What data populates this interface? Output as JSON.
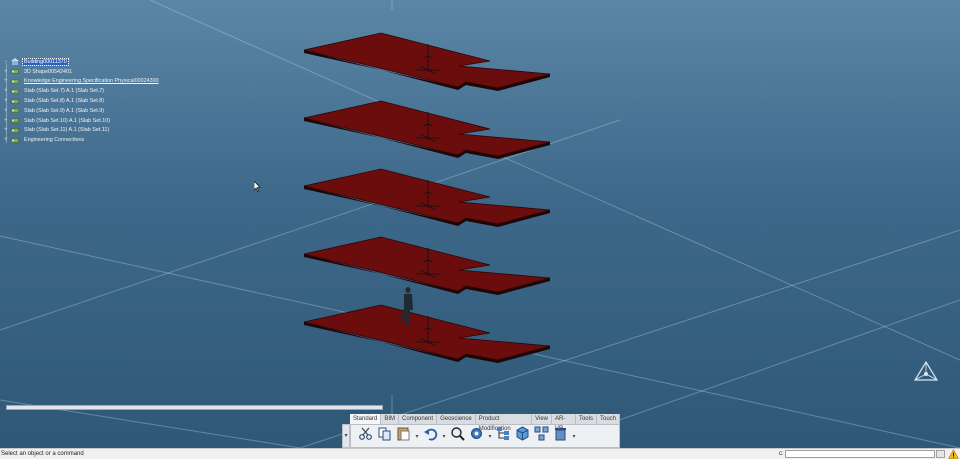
{
  "tree": {
    "root": "Building00011370",
    "items": [
      {
        "label": "3D Shape00542401",
        "style": "normal",
        "icon": "3d-shape-icon"
      },
      {
        "label": "Knowledge Engineering Specification Physical00024300",
        "style": "link",
        "icon": "knowledge-spec-icon"
      },
      {
        "label": "Slab (Slab Set.7) A.1 (Slab Set.7)",
        "style": "normal",
        "icon": "slab-icon"
      },
      {
        "label": "Slab (Slab Set.8) A.1 (Slab Set.8)",
        "style": "normal",
        "icon": "slab-icon"
      },
      {
        "label": "Slab (Slab Set.9) A.1 (Slab Set.9)",
        "style": "normal",
        "icon": "slab-icon"
      },
      {
        "label": "Slab (Slab Set.10) A.1 (Slab Set.10)",
        "style": "normal",
        "icon": "slab-icon"
      },
      {
        "label": "Slab (Slab Set.11) A.1 (Slab Set.11)",
        "style": "normal",
        "icon": "slab-icon"
      },
      {
        "label": "Engineering Connections",
        "style": "normal",
        "icon": "engineering-connections-icon"
      }
    ]
  },
  "toolbar": {
    "tabs": [
      "Standard",
      "BIM",
      "Component",
      "Geoscience",
      "Product Modification",
      "View",
      "AR-VR",
      "Tools",
      "Touch"
    ],
    "active_tab": "Standard",
    "tools": [
      {
        "name": "cut-icon",
        "has_dropdown": false
      },
      {
        "name": "copy-icon",
        "has_dropdown": false
      },
      {
        "name": "paste-icon",
        "has_dropdown": true
      },
      {
        "name": "undo-icon",
        "has_dropdown": true
      },
      {
        "name": "zoom-icon",
        "has_dropdown": false
      },
      {
        "name": "settings-gear-icon",
        "has_dropdown": true
      },
      {
        "name": "graph-tree-icon",
        "has_dropdown": false
      },
      {
        "name": "cube-view-icon",
        "has_dropdown": false
      },
      {
        "name": "network-icon",
        "has_dropdown": false
      },
      {
        "name": "delete-icon",
        "has_dropdown": true
      }
    ]
  },
  "status": {
    "message": "Select an object or a command",
    "command_prefix": "c:",
    "command_value": ""
  },
  "scene": {
    "slab_color": "#6b0d0d",
    "slab_count": 5
  },
  "colors": {
    "background_top": "#5b86a6",
    "background_bottom": "#2f5877",
    "selection": "#2a62c4"
  }
}
